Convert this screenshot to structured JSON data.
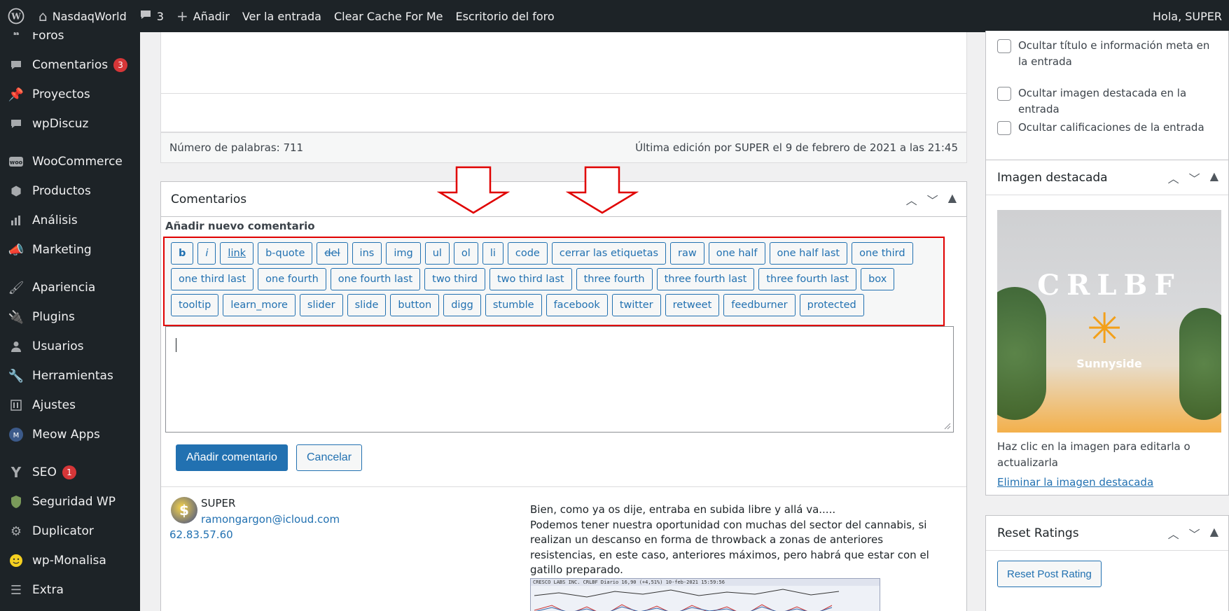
{
  "adminbar": {
    "site_name": "NasdaqWorld",
    "comments_count": "3",
    "add_new": "Añadir",
    "view_post": "Ver la entrada",
    "clear_cache": "Clear Cache For Me",
    "forum_desk": "Escritorio del foro",
    "greeting": "Hola, SUPER"
  },
  "sidebar": {
    "items": [
      {
        "label": "Foros",
        "icon": "forums-icon"
      },
      {
        "label": "Comentarios",
        "icon": "comments-icon",
        "badge": "3"
      },
      {
        "label": "Proyectos",
        "icon": "pin-icon"
      },
      {
        "label": "wpDiscuz",
        "icon": "chat-icon"
      },
      {
        "label": "WooCommerce",
        "icon": "woo-icon"
      },
      {
        "label": "Productos",
        "icon": "box-icon"
      },
      {
        "label": "Análisis",
        "icon": "bar-chart-icon"
      },
      {
        "label": "Marketing",
        "icon": "megaphone-icon"
      },
      {
        "label": "Apariencia",
        "icon": "brush-icon"
      },
      {
        "label": "Plugins",
        "icon": "plug-icon"
      },
      {
        "label": "Usuarios",
        "icon": "user-icon"
      },
      {
        "label": "Herramientas",
        "icon": "wrench-icon"
      },
      {
        "label": "Ajustes",
        "icon": "sliders-icon"
      },
      {
        "label": "Meow Apps",
        "icon": "meow-icon"
      },
      {
        "label": "SEO",
        "icon": "seo-icon",
        "badge": "1"
      },
      {
        "label": "Seguridad WP",
        "icon": "shield-icon"
      },
      {
        "label": "Duplicator",
        "icon": "gear-icon"
      },
      {
        "label": "wp-Monalisa",
        "icon": "smiley-icon"
      },
      {
        "label": "Extra",
        "icon": "menu-icon"
      }
    ]
  },
  "editor": {
    "word_count": "Número de palabras: 711",
    "last_edit": "Última edición por SUPER el 9 de febrero de 2021 a las 21:45"
  },
  "comments_box": {
    "title": "Comentarios",
    "add_new_label": "Añadir nuevo comentario",
    "quicktags": [
      "b",
      "i",
      "link",
      "b-quote",
      "del",
      "ins",
      "img",
      "ul",
      "ol",
      "li",
      "code",
      "cerrar las etiquetas",
      "raw",
      "one half",
      "one half last",
      "one third",
      "one third last",
      "one fourth",
      "one fourth last",
      "two third",
      "two third last",
      "three fourth",
      "three fourth last",
      "three fourth last",
      "box",
      "tooltip",
      "learn_more",
      "slider",
      "slide",
      "button",
      "digg",
      "stumble",
      "facebook",
      "twitter",
      "retweet",
      "feedburner",
      "protected"
    ],
    "submit_label": "Añadir comentario",
    "cancel_label": "Cancelar",
    "comment": {
      "author": "SUPER",
      "email": "ramongargon@icloud.com",
      "ip": "62.83.57.60",
      "lines": [
        "Bien, como ya os dije, entraba en subida libre y allá va.....",
        "Podemos tener nuestra oportunidad con muchas del sector del cannabis, si realizan un descanso en forma de throwback a zonas de anteriores resistencias, en este caso, anteriores máximos, pero habrá que estar con el gatillo preparado."
      ],
      "chart_caption": "CRESCO LABS INC. CRLBF Diario 16,90 (+4,51%) 10-feb-2021 15:59:56"
    }
  },
  "sidecol": {
    "checks": [
      "Ocultar título e información meta en la entrada",
      "Ocultar imagen destacada en la entrada",
      "Ocultar calificaciones de la entrada"
    ],
    "featured": {
      "title": "Imagen destacada",
      "image_title": "CRLBF",
      "image_sub": "Sunnyside",
      "help": "Haz clic en la imagen para editarla o actualizarla",
      "remove": "Eliminar la imagen destacada"
    },
    "reset": {
      "title": "Reset Ratings",
      "button": "Reset Post Rating"
    }
  },
  "colors": {
    "admin_dark": "#1d2327",
    "accent": "#2271b1",
    "highlight_red": "#e00000",
    "badge": "#d63638"
  }
}
